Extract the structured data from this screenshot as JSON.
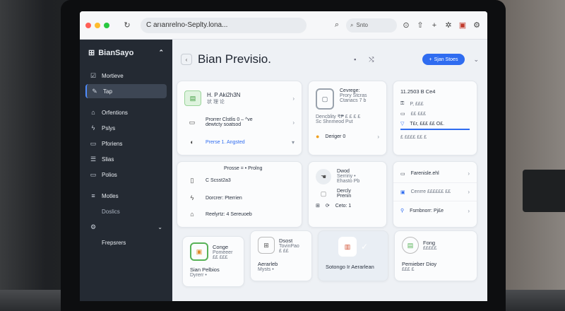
{
  "browser": {
    "address": "C arıanrelno-Seplty.lona...",
    "search_label": "Snto"
  },
  "sidebar": {
    "brand": "BianSayo",
    "items": [
      {
        "label": "Mortieve",
        "icon": "checkbox-icon"
      },
      {
        "label": "Tap",
        "icon": "edit-icon",
        "active": true
      },
      {
        "label": "Orfentions",
        "icon": "home-icon"
      },
      {
        "label": "Pslys",
        "icon": "spark-icon"
      },
      {
        "label": "Pforiens",
        "icon": "doc-icon"
      },
      {
        "label": "Slias",
        "icon": "list-icon"
      },
      {
        "label": "Polios",
        "icon": "doc-icon"
      },
      {
        "label": "Motles",
        "icon": "menu-icon"
      },
      {
        "label": "Doslics",
        "icon": ""
      },
      {
        "label": "Frepsrers",
        "icon": "gear-icon"
      }
    ]
  },
  "page": {
    "title": "Bian Previsio.",
    "primary_button": "Sjan Stoes"
  },
  "card_a": {
    "row1_title": "H. P Aki2h3N",
    "row1_sub": "状 理 论",
    "row2_line1": "Prorrer Clstlis 0 – ^ve",
    "row2_line2": "dewtcty soatsod",
    "row3_label": "Prerse 1. Angsted"
  },
  "card_b": {
    "lines": [
      "Cevrege:",
      "Prory Stcras",
      "Ctanacs 7 b"
    ],
    "meta_line1": "Dencblity ₹₱ £ £ £ £",
    "meta_line2": "Sc Shnmeod Put",
    "footer": "Deriger 0"
  },
  "card_c": {
    "title": "11.2503 B Ce4",
    "items": [
      "P, £££",
      "££ £££"
    ],
    "link": "T£r, £££ ££ O£.",
    "bottom": "£ ££££ ££ £"
  },
  "card_d": {
    "header": "Prosse = • Prolng",
    "sub": "C Scsst2a3",
    "row2": "Dorcrer: Pterrien",
    "row3": "Reelyrtz: 4 Sereuoeb"
  },
  "card_e": {
    "l1": "Dwod",
    "l2": "Serririy  •",
    "l3": "Ehasto Pb",
    "l4": "Dercly",
    "l5": "Prenin",
    "l6": "Ceto: 1"
  },
  "card_f": {
    "rows": [
      "Farenisle.ehl",
      "Cenrre  ££££££ ££",
      "Fsmbnorr: Pj£e"
    ]
  },
  "tiles": [
    {
      "title": "Conge",
      "sub1": "Pomeeer",
      "sub2": "££ £££",
      "name": "Sian Pelbios",
      "meta": "Dyrerr •"
    },
    {
      "title": "Dsost",
      "sub1": "TovinPao",
      "sub2": "£ ££",
      "name": "Aerarleb",
      "meta": "Mysts •"
    },
    {
      "title": "",
      "sub1": "",
      "sub2": "",
      "name": "Sotongo Ir Aerarlean",
      "meta": ""
    },
    {
      "title": "Fong",
      "sub1": "£££££",
      "sub2": "",
      "name": "Pemieber Dioy",
      "meta": "£££ £"
    }
  ],
  "colors": {
    "accent": "#2f6cf0",
    "sidebar_bg": "#242a33",
    "green": "#4caf50"
  }
}
